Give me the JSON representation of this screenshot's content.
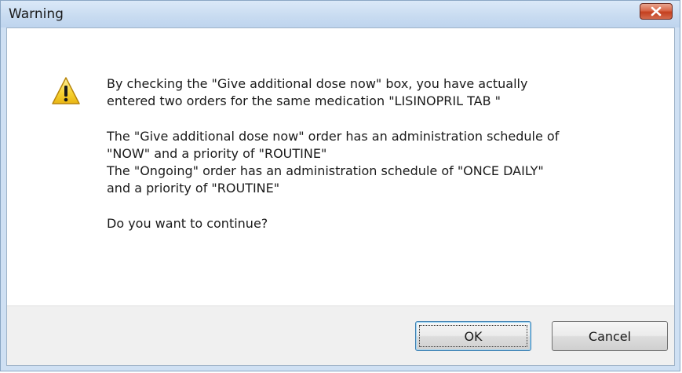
{
  "window": {
    "title": "Warning",
    "close_icon": "close-icon"
  },
  "dialog": {
    "icon": "warning-icon",
    "message": {
      "para1_line1": "By checking the \"Give additional dose now\" box, you have actually",
      "para1_line2": "entered two orders for the same medication \"LISINOPRIL TAB \"",
      "para2_line1": "The \"Give additional dose now\" order has an administration schedule of",
      "para2_line2": "\"NOW\" and a priority of \"ROUTINE\"",
      "para2_line3": "The \"Ongoing\" order has an administration schedule of \"ONCE DAILY\"",
      "para2_line4": "and a priority of \"ROUTINE\"",
      "question": "Do you want to continue?"
    }
  },
  "buttons": {
    "ok_label": "OK",
    "cancel_label": "Cancel"
  },
  "colors": {
    "titlebar": "#c9dcf1",
    "close_button": "#c4401f",
    "footer": "#f0f0f0",
    "warning_yellow": "#f7d230"
  }
}
